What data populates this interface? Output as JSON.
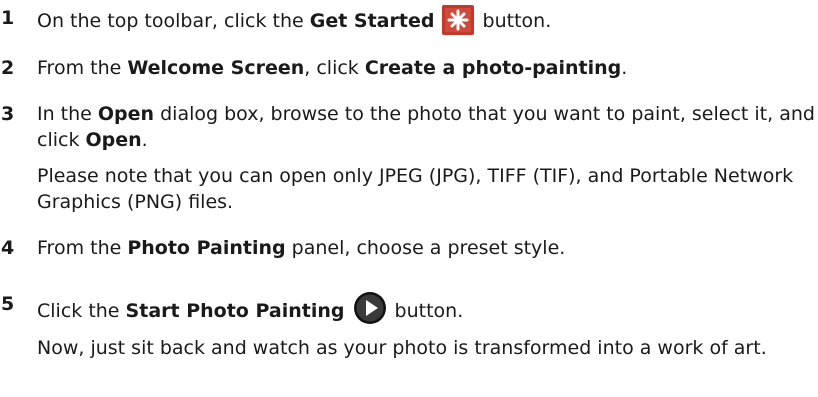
{
  "steps": [
    {
      "num": "1",
      "pre": "On the top toolbar, click the ",
      "bold": "Get Started",
      "post": " button."
    },
    {
      "num": "2",
      "pre": "From the ",
      "bold1": "Welcome Screen",
      "mid": ", click ",
      "bold2": "Create a photo-painting",
      "post": "."
    },
    {
      "num": "3",
      "pre": "In the ",
      "bold1": "Open",
      "mid": " dialog box, browse to the photo that you want to paint, select it, and click ",
      "bold2": "Open",
      "post": ".",
      "note": "Please note that you can open only JPEG (JPG), TIFF (TIF), and Portable Network Graphics (PNG) files."
    },
    {
      "num": "4",
      "pre": "From the ",
      "bold": "Photo Painting",
      "post": " panel, choose a preset style."
    },
    {
      "num": "5",
      "pre": "Click the ",
      "bold": "Start Photo Painting",
      "post": " button.",
      "note": "Now, just sit back and watch as your photo is transformed into a work of art."
    }
  ],
  "icons": {
    "get_started": "snowflake-star-icon",
    "start_painting": "play-icon",
    "get_started_bg": "#c0392b",
    "start_painting_bg": "#111111"
  }
}
